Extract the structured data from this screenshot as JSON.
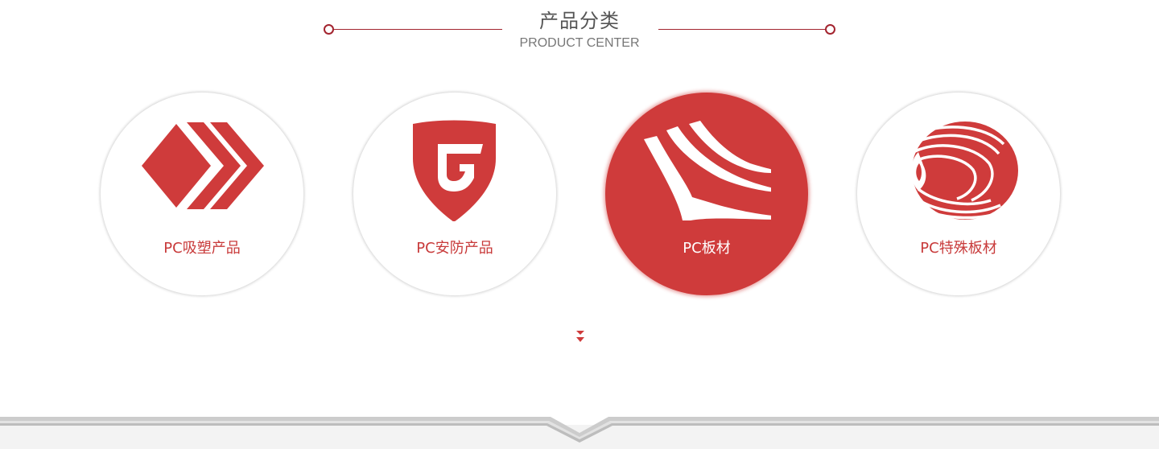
{
  "header": {
    "title_cn": "产品分类",
    "title_en": "PRODUCT CENTER"
  },
  "products": [
    {
      "label": "PC吸塑产品",
      "icon": "double-chevron-diamond-icon",
      "active": false
    },
    {
      "label": "PC安防产品",
      "icon": "shield-g-icon",
      "active": false
    },
    {
      "label": "PC板材",
      "icon": "curved-sheets-icon",
      "active": true
    },
    {
      "label": "PC特殊板材",
      "icon": "concentric-wave-icon",
      "active": false
    }
  ],
  "colors": {
    "accent": "#cf3b3b",
    "deco_line": "#a3242f",
    "heading": "#555555",
    "subheading": "#777777"
  }
}
